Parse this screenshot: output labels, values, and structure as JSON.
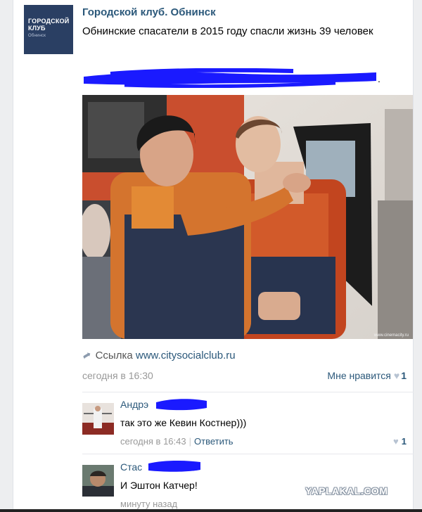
{
  "group": {
    "avatar_lines": [
      "ГОРОДСКОЙ",
      "КЛУБ"
    ],
    "avatar_sub": "Обнинск",
    "name": "Городской клуб. Обнинск",
    "text": "Обнинские спасатели в 2015 году спасли жизнь 39 человек",
    "redacted_suffix": "."
  },
  "post": {
    "link_prefix": "Ссылка",
    "link_url": "www.citysocialclub.ru",
    "time": "сегодня в 16:30",
    "like_label": "Мне нравится",
    "like_count": "1",
    "image_caption": "www.cinemacity.ru"
  },
  "comments": [
    {
      "author": "Андрэ",
      "text": "так это же Кевин Костнер)))",
      "time": "сегодня в 16:43",
      "reply_label": "Ответить",
      "like_count": "1"
    },
    {
      "author": "Стас",
      "text": "И Эштон Катчер!",
      "time": "минуту назад"
    }
  ],
  "watermark": "YAPLAKAL.COM",
  "colors": {
    "link": "#2b587a",
    "muted": "#999999",
    "redaction": "#1a1aff",
    "heart": "#b7c3d2"
  },
  "icons": [
    "share-arrow-icon",
    "heart-icon"
  ]
}
